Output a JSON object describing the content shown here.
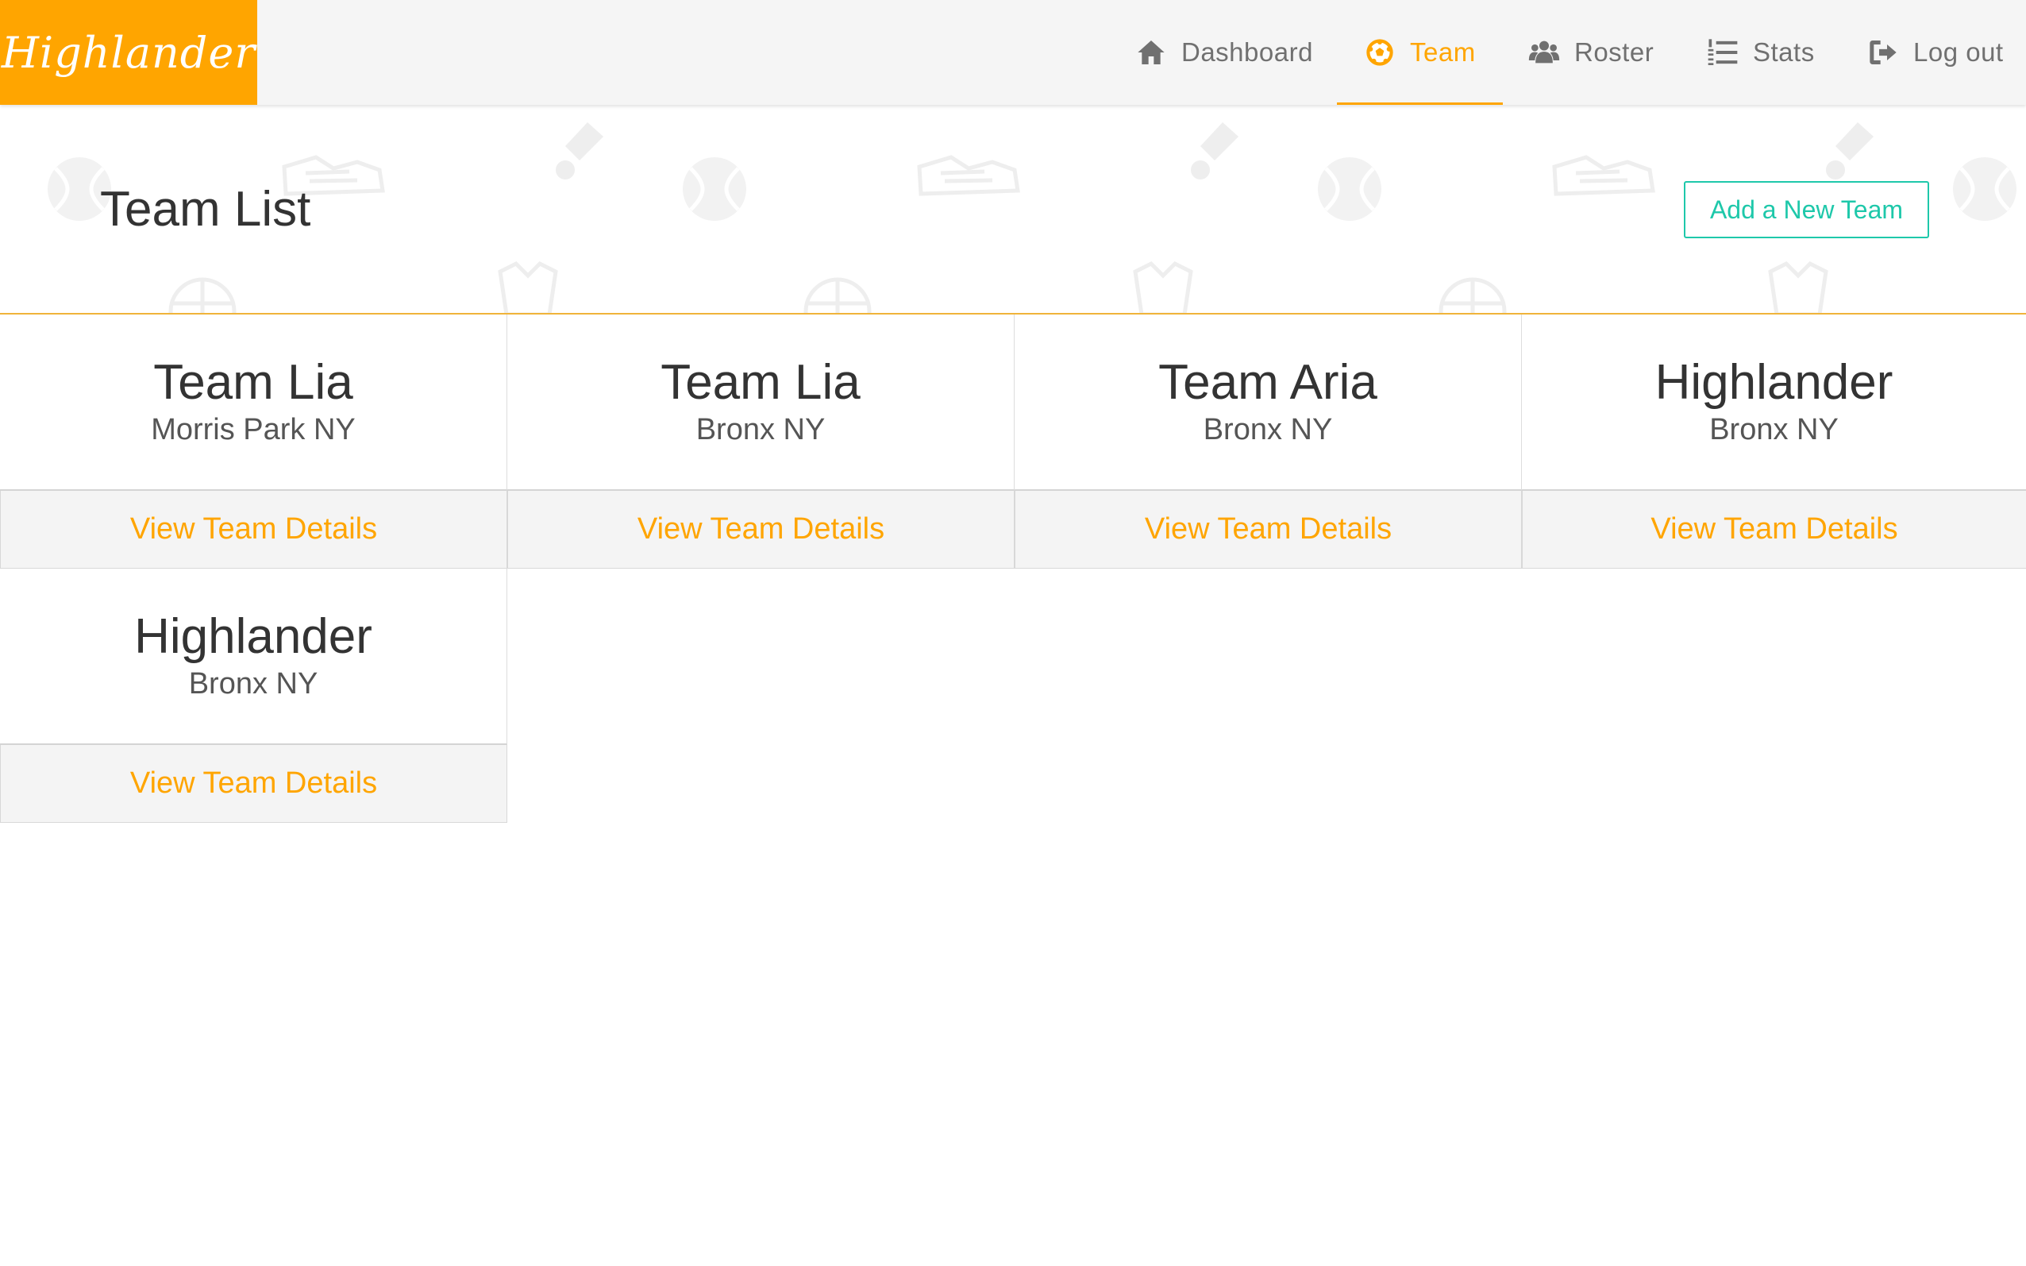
{
  "brand": {
    "name": "Highlander"
  },
  "nav": {
    "items": [
      {
        "label": "Dashboard",
        "icon": "home-icon"
      },
      {
        "label": "Team",
        "icon": "soccer-ball-icon",
        "active": true
      },
      {
        "label": "Roster",
        "icon": "users-icon"
      },
      {
        "label": "Stats",
        "icon": "list-ordered-icon"
      },
      {
        "label": "Log out",
        "icon": "sign-out-icon"
      }
    ]
  },
  "header": {
    "title": "Team List",
    "add_button": "Add a New Team"
  },
  "teams": [
    {
      "name": "Team Lia",
      "location": "Morris Park NY",
      "link": "View Team Details"
    },
    {
      "name": "Team Lia",
      "location": "Bronx NY",
      "link": "View Team Details"
    },
    {
      "name": "Team Aria",
      "location": "Bronx NY",
      "link": "View Team Details"
    },
    {
      "name": "Highlander",
      "location": "Bronx NY",
      "link": "View Team Details"
    },
    {
      "name": "Highlander",
      "location": "Bronx NY",
      "link": "View Team Details"
    }
  ],
  "colors": {
    "accent": "#ffa500",
    "teal": "#1ec8aa",
    "nav_bg": "#f5f5f5",
    "nav_text": "#707070"
  }
}
